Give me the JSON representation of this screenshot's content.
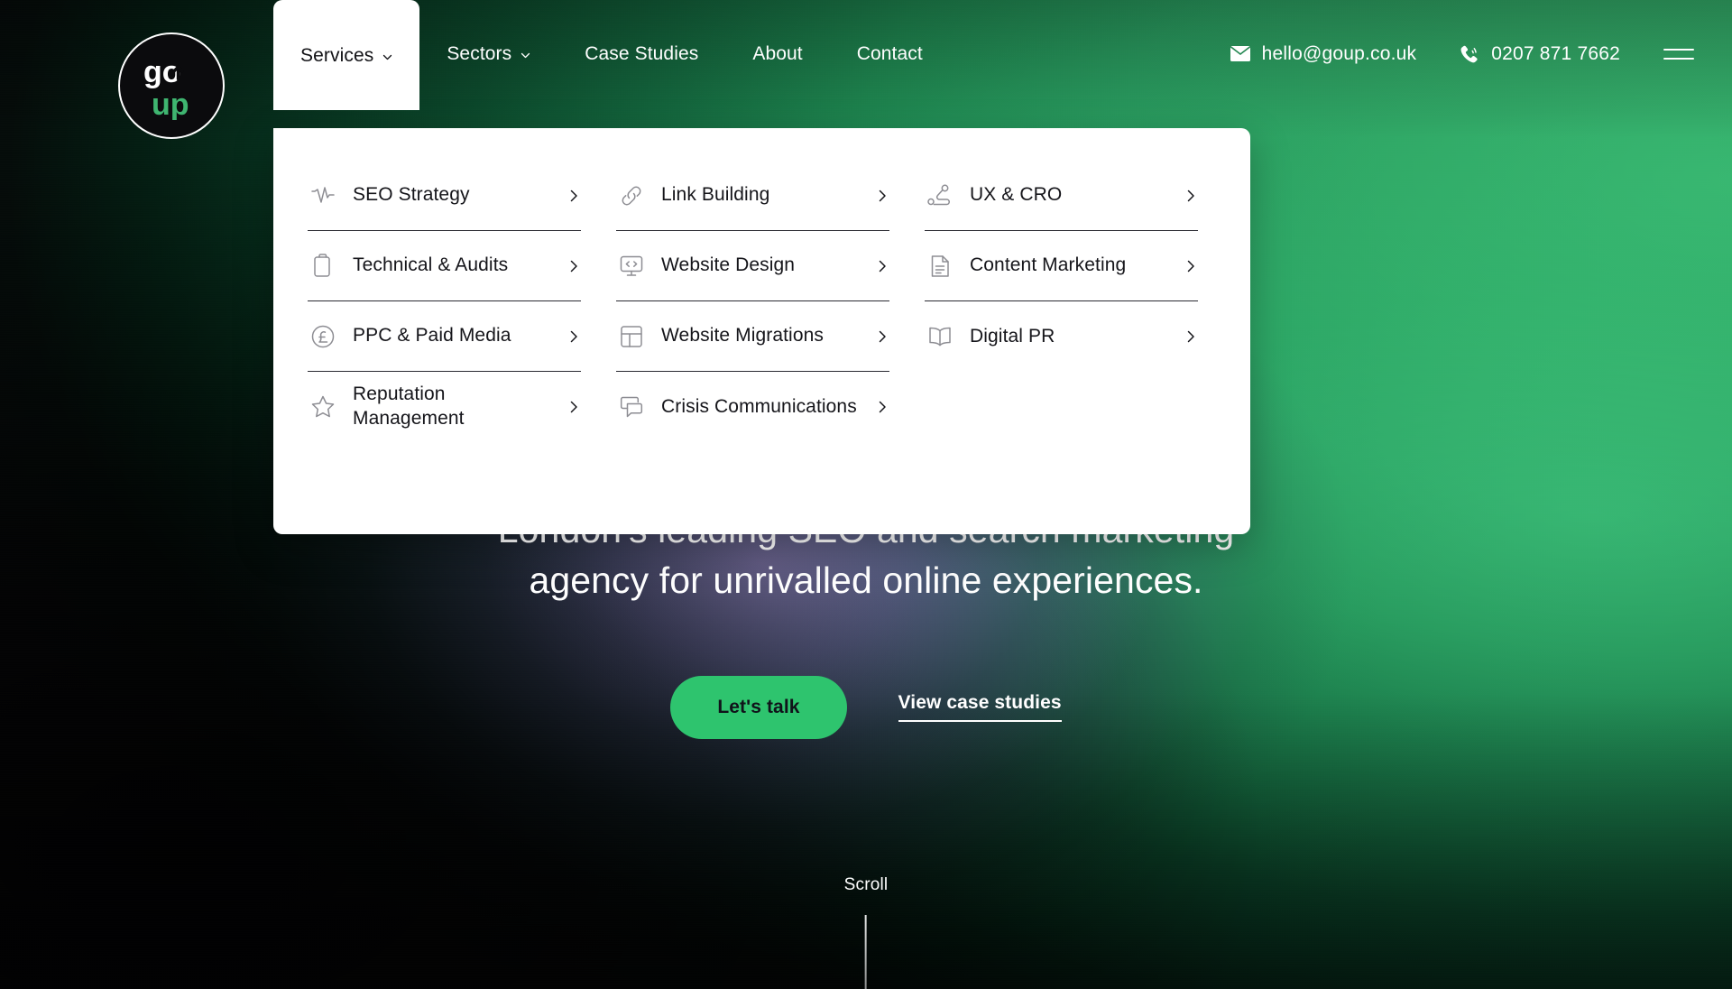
{
  "brand": {
    "logo_text_top": "go",
    "logo_text_bottom": "up",
    "logo_name": "GoUp",
    "accent_green": "#2ec46e",
    "panel_white": "#ffffff",
    "ink": "#15151a"
  },
  "header": {
    "nav": [
      {
        "label": "Services",
        "has_caret": true,
        "active": true
      },
      {
        "label": "Sectors",
        "has_caret": true,
        "active": false
      },
      {
        "label": "Case Studies",
        "has_caret": false,
        "active": false
      },
      {
        "label": "About",
        "has_caret": false,
        "active": false
      },
      {
        "label": "Contact",
        "has_caret": false,
        "active": false
      }
    ],
    "email": "hello@goup.co.uk",
    "email_icon": "envelope-icon",
    "phone": "0207 871 7662",
    "phone_icon": "phone-ringing-icon",
    "menu_icon": "hamburger-menu-icon"
  },
  "mega_menu": {
    "open_for": "Services",
    "columns": [
      {
        "items": [
          {
            "label": "SEO Strategy",
            "icon": "activity-pulse-icon",
            "chevron": "chevron-right-icon"
          },
          {
            "label": "Technical & Audits",
            "icon": "clipboard-icon",
            "chevron": "chevron-right-icon"
          },
          {
            "label": "PPC & Paid Media",
            "icon": "pound-coin-icon",
            "chevron": "chevron-right-icon"
          },
          {
            "label": "Reputation Management",
            "icon": "star-icon",
            "chevron": "chevron-right-icon"
          }
        ]
      },
      {
        "items": [
          {
            "label": "Link Building",
            "icon": "link-chain-icon",
            "chevron": "chevron-right-icon"
          },
          {
            "label": "Website Design",
            "icon": "code-monitor-icon",
            "chevron": "chevron-right-icon"
          },
          {
            "label": "Website Migrations",
            "icon": "layout-grid-icon",
            "chevron": "chevron-right-icon"
          },
          {
            "label": "Crisis Communications",
            "icon": "speech-bubbles-icon",
            "chevron": "chevron-right-icon"
          }
        ]
      },
      {
        "items": [
          {
            "label": "UX & CRO",
            "icon": "user-journey-icon",
            "chevron": "chevron-right-icon"
          },
          {
            "label": "Content Marketing",
            "icon": "document-lines-icon",
            "chevron": "chevron-right-icon"
          },
          {
            "label": "Digital PR",
            "icon": "open-book-icon",
            "chevron": "chevron-right-icon"
          }
        ]
      }
    ]
  },
  "hero": {
    "headline_line1": "London's leading SEO and search marketing",
    "headline_line2": "agency for unrivalled online experiences.",
    "primary_cta": "Let's talk",
    "secondary_cta": "View case studies"
  },
  "scroll": {
    "label": "Scroll"
  }
}
